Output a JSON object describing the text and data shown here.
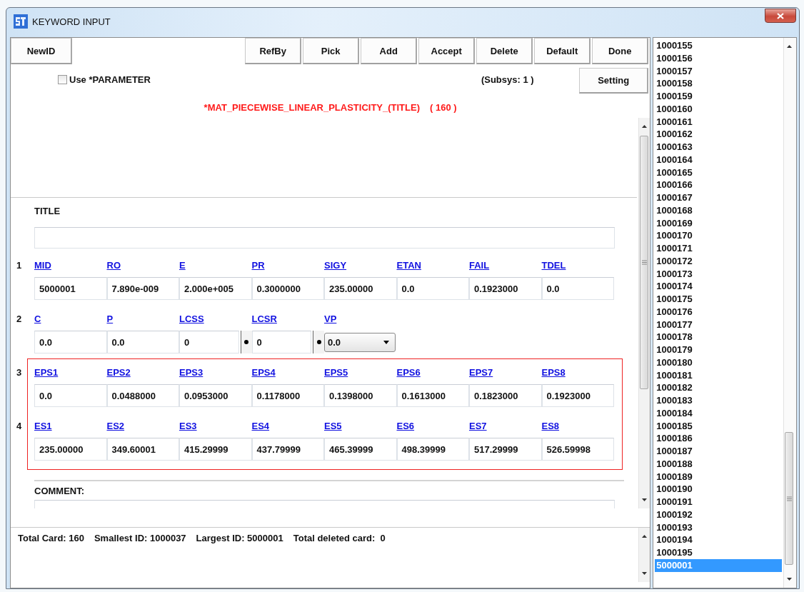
{
  "window": {
    "title": "KEYWORD INPUT"
  },
  "toolbar_left": [
    "NewID"
  ],
  "toolbar_right": [
    "RefBy",
    "Pick",
    "Add",
    "Accept",
    "Delete",
    "Default",
    "Done"
  ],
  "use_parameter": {
    "label": "Use *PARAMETER",
    "checked": false
  },
  "subsys": "(Subsys: 1 )",
  "setting_button": "Setting",
  "keyword": "*MAT_PIECEWISE_LINEAR_PLASTICITY_(TITLE)",
  "card_count": "( 160 )",
  "title_field": {
    "label": "TITLE"
  },
  "cards": [
    {
      "number": "1",
      "highlighted": false,
      "fields": [
        {
          "name": "MID",
          "value": "5000001",
          "kind": "input"
        },
        {
          "name": "RO",
          "value": "7.890e-009",
          "kind": "input"
        },
        {
          "name": "E",
          "value": "2.000e+005",
          "kind": "input"
        },
        {
          "name": "PR",
          "value": "0.3000000",
          "kind": "input"
        },
        {
          "name": "SIGY",
          "value": "235.00000",
          "kind": "input"
        },
        {
          "name": "ETAN",
          "value": "0.0",
          "kind": "input"
        },
        {
          "name": "FAIL",
          "value": "0.1923000",
          "kind": "input"
        },
        {
          "name": "TDEL",
          "value": "0.0",
          "kind": "input"
        }
      ]
    },
    {
      "number": "2",
      "highlighted": false,
      "fields": [
        {
          "name": "C",
          "value": "0.0",
          "kind": "input"
        },
        {
          "name": "P",
          "value": "0.0",
          "kind": "input"
        },
        {
          "name": "LCSS",
          "value": "0",
          "kind": "curve"
        },
        {
          "name": "LCSR",
          "value": "0",
          "kind": "curve"
        },
        {
          "name": "VP",
          "value": "0.0",
          "kind": "dropdown"
        }
      ]
    },
    {
      "number": "3",
      "highlighted": true,
      "fields": [
        {
          "name": "EPS1",
          "value": "0.0",
          "kind": "input"
        },
        {
          "name": "EPS2",
          "value": "0.0488000",
          "kind": "input"
        },
        {
          "name": "EPS3",
          "value": "0.0953000",
          "kind": "input"
        },
        {
          "name": "EPS4",
          "value": "0.1178000",
          "kind": "input"
        },
        {
          "name": "EPS5",
          "value": "0.1398000",
          "kind": "input"
        },
        {
          "name": "EPS6",
          "value": "0.1613000",
          "kind": "input"
        },
        {
          "name": "EPS7",
          "value": "0.1823000",
          "kind": "input"
        },
        {
          "name": "EPS8",
          "value": "0.1923000",
          "kind": "input"
        }
      ]
    },
    {
      "number": "4",
      "highlighted": true,
      "fields": [
        {
          "name": "ES1",
          "value": "235.00000",
          "kind": "input"
        },
        {
          "name": "ES2",
          "value": "349.60001",
          "kind": "input"
        },
        {
          "name": "ES3",
          "value": "415.29999",
          "kind": "input"
        },
        {
          "name": "ES4",
          "value": "437.79999",
          "kind": "input"
        },
        {
          "name": "ES5",
          "value": "465.39999",
          "kind": "input"
        },
        {
          "name": "ES6",
          "value": "498.39999",
          "kind": "input"
        },
        {
          "name": "ES7",
          "value": "517.29999",
          "kind": "input"
        },
        {
          "name": "ES8",
          "value": "526.59998",
          "kind": "input"
        }
      ]
    }
  ],
  "comment": {
    "label": "COMMENT:"
  },
  "status": [
    "Total Card: 160",
    "Smallest ID: 1000037",
    "Largest ID: 5000001",
    "Total deleted card:  0"
  ],
  "id_list": [
    {
      "label": "1000155",
      "selected": false
    },
    {
      "label": "1000156",
      "selected": false
    },
    {
      "label": "1000157",
      "selected": false
    },
    {
      "label": "1000158",
      "selected": false
    },
    {
      "label": "1000159",
      "selected": false
    },
    {
      "label": "1000160",
      "selected": false
    },
    {
      "label": "1000161",
      "selected": false
    },
    {
      "label": "1000162",
      "selected": false
    },
    {
      "label": "1000163",
      "selected": false
    },
    {
      "label": "1000164",
      "selected": false
    },
    {
      "label": "1000165",
      "selected": false
    },
    {
      "label": "1000166",
      "selected": false
    },
    {
      "label": "1000167",
      "selected": false
    },
    {
      "label": "1000168",
      "selected": false
    },
    {
      "label": "1000169",
      "selected": false
    },
    {
      "label": "1000170",
      "selected": false
    },
    {
      "label": "1000171",
      "selected": false
    },
    {
      "label": "1000172",
      "selected": false
    },
    {
      "label": "1000173",
      "selected": false
    },
    {
      "label": "1000174",
      "selected": false
    },
    {
      "label": "1000175",
      "selected": false
    },
    {
      "label": "1000176",
      "selected": false
    },
    {
      "label": "1000177",
      "selected": false
    },
    {
      "label": "1000178",
      "selected": false
    },
    {
      "label": "1000179",
      "selected": false
    },
    {
      "label": "1000180",
      "selected": false
    },
    {
      "label": "1000181",
      "selected": false
    },
    {
      "label": "1000182",
      "selected": false
    },
    {
      "label": "1000183",
      "selected": false
    },
    {
      "label": "1000184",
      "selected": false
    },
    {
      "label": "1000185",
      "selected": false
    },
    {
      "label": "1000186",
      "selected": false
    },
    {
      "label": "1000187",
      "selected": false
    },
    {
      "label": "1000188",
      "selected": false
    },
    {
      "label": "1000189",
      "selected": false
    },
    {
      "label": "1000190",
      "selected": false
    },
    {
      "label": "1000191",
      "selected": false
    },
    {
      "label": "1000192",
      "selected": false
    },
    {
      "label": "1000193",
      "selected": false
    },
    {
      "label": "1000194",
      "selected": false
    },
    {
      "label": "1000195",
      "selected": false
    },
    {
      "label": "5000001",
      "selected": true
    }
  ]
}
